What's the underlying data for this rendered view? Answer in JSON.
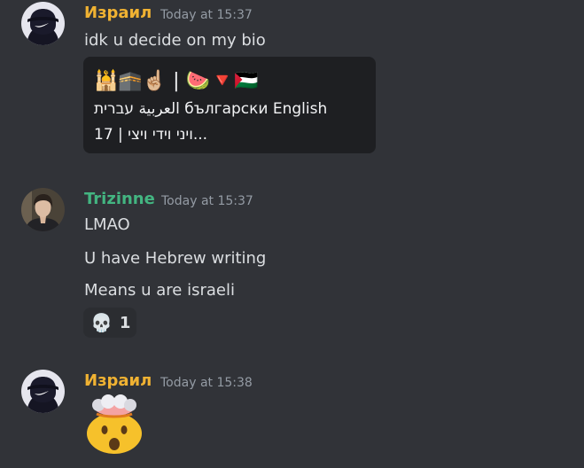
{
  "messages": [
    {
      "author": "Израил",
      "author_color": "#f0b232",
      "timestamp": "Today at 15:37",
      "text": "idk u decide on my bio",
      "embed": {
        "line1": "🕌🕋☝🏼 | 🍉🔻🇵🇸",
        "line2": "العربية עברית български English",
        "line3": "17 | ויני וידי ויצי..."
      }
    },
    {
      "author": "Trizinne",
      "author_color": "#43b581",
      "timestamp": "Today at 15:37",
      "lines": [
        "LMAO",
        "U have Hebrew writing",
        "Means u are israeli"
      ],
      "reaction": {
        "emoji": "💀",
        "count": "1"
      }
    },
    {
      "author": "Израил",
      "author_color": "#f0b232",
      "timestamp": "Today at 15:38",
      "emoji": "exploding-head"
    }
  ]
}
